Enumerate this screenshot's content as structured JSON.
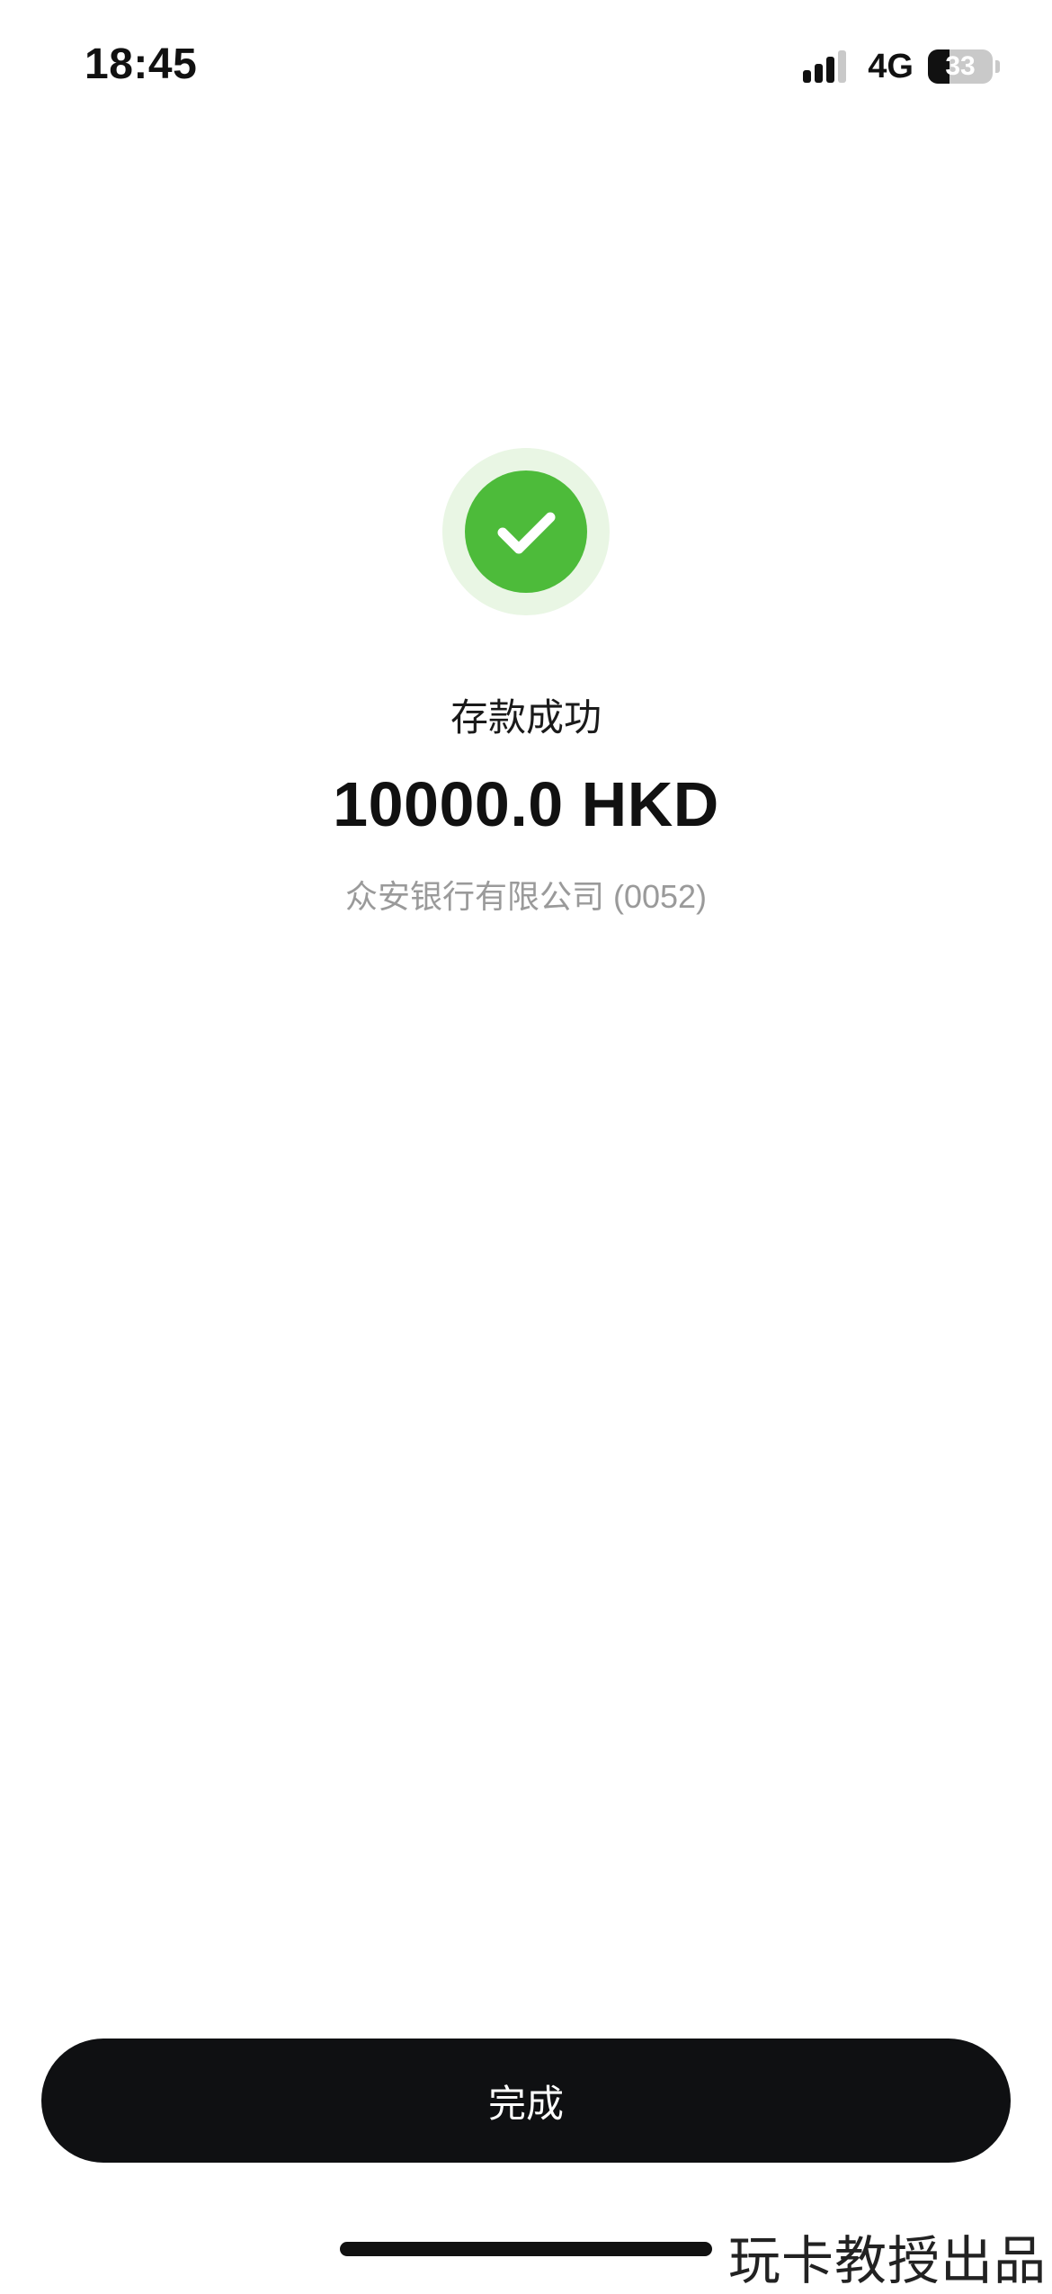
{
  "status_bar": {
    "time": "18:45",
    "network": "4G",
    "battery_level": "33",
    "battery_fraction": 0.33
  },
  "icons": {
    "signal": "signal-bars-icon",
    "battery": "battery-icon",
    "success": "checkmark-circle-icon"
  },
  "colors": {
    "success_green": "#4dbb3a",
    "success_halo": "#e9f6e4",
    "button_bg": "#0f1012",
    "muted_text": "#9a9a9a"
  },
  "result": {
    "title": "存款成功",
    "amount": "10000.0 HKD",
    "bank": "众安银行有限公司 (0052)"
  },
  "actions": {
    "done_label": "完成"
  },
  "watermark": "玩卡教授出品"
}
